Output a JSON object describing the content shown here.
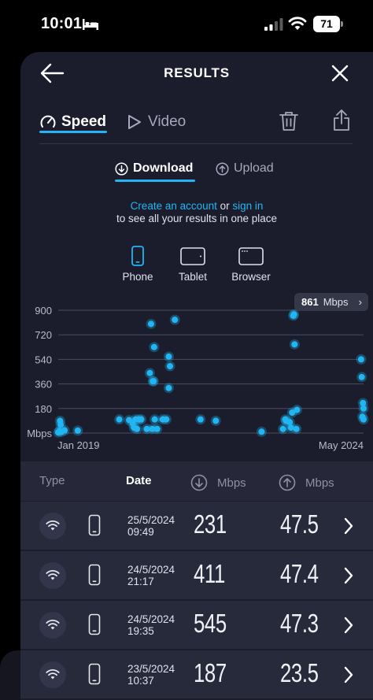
{
  "status_bar": {
    "time": "10:01",
    "battery": "71"
  },
  "header": {
    "title": "RESULTS"
  },
  "tabs": {
    "speed": "Speed",
    "video": "Video"
  },
  "subtabs": {
    "download": "Download",
    "upload": "Upload"
  },
  "account": {
    "create_link": "Create an account",
    "or": " or ",
    "signin_link": "sign in",
    "line2": "to see all your results in one place"
  },
  "devices": {
    "phone": "Phone",
    "tablet": "Tablet",
    "browser": "Browser"
  },
  "colors": {
    "accent": "#21b6f3",
    "background": "#1b1d2d",
    "row": "#272a3b"
  },
  "tooltip": {
    "value": "861",
    "unit": "Mbps"
  },
  "chart_data": {
    "type": "scatter",
    "ylabel": "Mbps",
    "y_ticks": [
      "900",
      "720",
      "540",
      "360",
      "180"
    ],
    "y_tick_values": [
      900,
      720,
      540,
      360,
      180
    ],
    "ylim": [
      0,
      900
    ],
    "xlim": [
      0,
      1
    ],
    "x_labels": [
      "Jan 2019",
      "May 2024"
    ],
    "grid": true,
    "series": [
      {
        "values": [
          [
            0.0,
            5
          ],
          [
            0.004,
            15
          ],
          [
            0.006,
            90
          ],
          [
            0.008,
            60
          ],
          [
            0.011,
            10
          ],
          [
            0.021,
            20
          ],
          [
            0.064,
            18
          ],
          [
            0.2,
            100
          ],
          [
            0.232,
            95
          ],
          [
            0.244,
            70
          ],
          [
            0.248,
            40
          ],
          [
            0.253,
            100
          ],
          [
            0.258,
            30
          ],
          [
            0.265,
            100
          ],
          [
            0.272,
            100
          ],
          [
            0.29,
            30
          ],
          [
            0.3,
            440
          ],
          [
            0.304,
            800
          ],
          [
            0.308,
            30
          ],
          [
            0.31,
            380
          ],
          [
            0.312,
            380
          ],
          [
            0.314,
            630
          ],
          [
            0.316,
            100
          ],
          [
            0.324,
            30
          ],
          [
            0.342,
            100
          ],
          [
            0.354,
            100
          ],
          [
            0.362,
            560
          ],
          [
            0.362,
            330
          ],
          [
            0.366,
            490
          ],
          [
            0.382,
            830
          ],
          [
            0.466,
            100
          ],
          [
            0.516,
            90
          ],
          [
            0.666,
            10
          ],
          [
            0.736,
            30
          ],
          [
            0.744,
            100
          ],
          [
            0.746,
            90
          ],
          [
            0.758,
            80
          ],
          [
            0.762,
            40
          ],
          [
            0.766,
            150
          ],
          [
            0.77,
            860
          ],
          [
            0.772,
            870
          ],
          [
            0.774,
            650
          ],
          [
            0.78,
            30
          ],
          [
            0.782,
            170
          ],
          [
            0.992,
            540
          ],
          [
            0.994,
            410
          ],
          [
            0.996,
            120
          ],
          [
            0.998,
            220
          ],
          [
            1.0,
            180
          ],
          [
            1.0,
            100
          ]
        ]
      }
    ]
  },
  "table": {
    "headers": {
      "type": "Type",
      "date": "Date",
      "download": "Mbps",
      "upload": "Mbps"
    },
    "rows": [
      {
        "date": "25/5/2024",
        "time": "09:49",
        "download": "231",
        "upload": "47.5"
      },
      {
        "date": "24/5/2024",
        "time": "21:17",
        "download": "411",
        "upload": "47.4"
      },
      {
        "date": "24/5/2024",
        "time": "19:35",
        "download": "545",
        "upload": "47.3"
      },
      {
        "date": "23/5/2024",
        "time": "10:37",
        "download": "187",
        "upload": "23.5"
      }
    ]
  }
}
